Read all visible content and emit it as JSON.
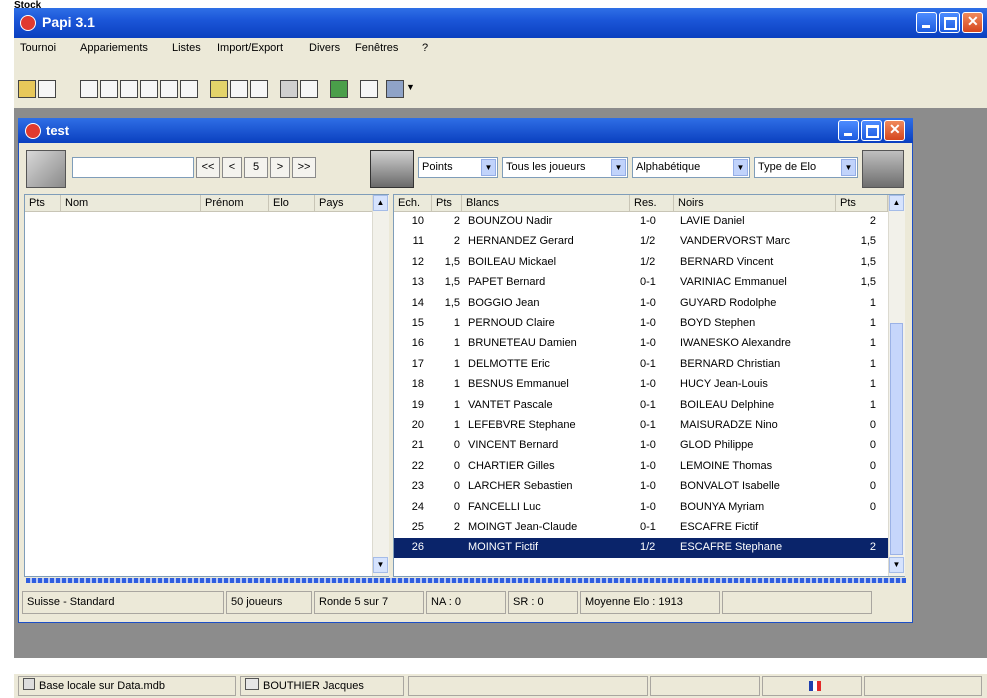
{
  "corner_label": "Stock",
  "app": {
    "title": "Papi 3.1"
  },
  "menu": [
    "Tournoi",
    "Appariements",
    "Listes",
    "Import/Export",
    "Divers",
    "Fenêtres",
    "?"
  ],
  "window": {
    "title": "test"
  },
  "nav": {
    "search_value": "",
    "first": "<<",
    "prev": "<",
    "round": "5",
    "next": ">",
    "last": ">>"
  },
  "filters": {
    "points": "Points",
    "players": "Tous les joueurs",
    "order": "Alphabétique",
    "elo_type": "Type de Elo"
  },
  "left_headers": [
    "Pts",
    "Nom",
    "Prénom",
    "Elo",
    "Pays"
  ],
  "right_headers": {
    "board": "Ech.",
    "pts": "Pts",
    "white": "Blancs",
    "res": "Res.",
    "black": "Noirs",
    "pts2": "Pts"
  },
  "pairings": [
    {
      "board": "10",
      "wpts": "2",
      "white": "BOUNZOU Nadir",
      "res": "1-0",
      "black": "LAVIE Daniel",
      "bpts": "2"
    },
    {
      "board": "11",
      "wpts": "2",
      "white": "HERNANDEZ Gerard",
      "res": "1/2",
      "black": "VANDERVORST Marc",
      "bpts": "1,5"
    },
    {
      "board": "12",
      "wpts": "1,5",
      "white": "BOILEAU Mickael",
      "res": "1/2",
      "black": "BERNARD Vincent",
      "bpts": "1,5"
    },
    {
      "board": "13",
      "wpts": "1,5",
      "white": "PAPET Bernard",
      "res": "0-1",
      "black": "VARINIAC Emmanuel",
      "bpts": "1,5"
    },
    {
      "board": "14",
      "wpts": "1,5",
      "white": "BOGGIO Jean",
      "res": "1-0",
      "black": "GUYARD Rodolphe",
      "bpts": "1"
    },
    {
      "board": "15",
      "wpts": "1",
      "white": "PERNOUD Claire",
      "res": "1-0",
      "black": "BOYD Stephen",
      "bpts": "1"
    },
    {
      "board": "16",
      "wpts": "1",
      "white": "BRUNETEAU Damien",
      "res": "1-0",
      "black": "IWANESKO Alexandre",
      "bpts": "1"
    },
    {
      "board": "17",
      "wpts": "1",
      "white": "DELMOTTE Eric",
      "res": "0-1",
      "black": "BERNARD Christian",
      "bpts": "1"
    },
    {
      "board": "18",
      "wpts": "1",
      "white": "BESNUS Emmanuel",
      "res": "1-0",
      "black": "HUCY Jean-Louis",
      "bpts": "1"
    },
    {
      "board": "19",
      "wpts": "1",
      "white": "VANTET Pascale",
      "res": "0-1",
      "black": "BOILEAU Delphine",
      "bpts": "1"
    },
    {
      "board": "20",
      "wpts": "1",
      "white": "LEFEBVRE Stephane",
      "res": "0-1",
      "black": "MAISURADZE Nino",
      "bpts": "0"
    },
    {
      "board": "21",
      "wpts": "0",
      "white": "VINCENT Bernard",
      "res": "1-0",
      "black": "GLOD Philippe",
      "bpts": "0"
    },
    {
      "board": "22",
      "wpts": "0",
      "white": "CHARTIER Gilles",
      "res": "1-0",
      "black": "LEMOINE Thomas",
      "bpts": "0"
    },
    {
      "board": "23",
      "wpts": "0",
      "white": "LARCHER Sebastien",
      "res": "1-0",
      "black": "BONVALOT Isabelle",
      "bpts": "0"
    },
    {
      "board": "24",
      "wpts": "0",
      "white": "FANCELLI Luc",
      "res": "1-0",
      "black": "BOUNYA Myriam",
      "bpts": "0"
    },
    {
      "board": "25",
      "wpts": "2",
      "white": "MOINGT Jean-Claude",
      "res": "0-1",
      "black": "ESCAFRE Fictif",
      "bpts": ""
    },
    {
      "board": "26",
      "wpts": "",
      "white": "MOINGT Fictif",
      "res": "1/2",
      "black": "ESCAFRE Stephane",
      "bpts": "2",
      "selected": true
    }
  ],
  "status": {
    "system": "Suisse - Standard",
    "players": "50 joueurs",
    "round": "Ronde 5 sur 7",
    "na": "NA : 0",
    "sr": "SR : 0",
    "avg_elo": "Moyenne Elo : 1913"
  },
  "bottom": {
    "db": "Base locale sur Data.mdb",
    "user": "BOUTHIER Jacques"
  },
  "colors": {
    "titlebar": "#0a3fbf",
    "selection": "#0a246a",
    "window_bg": "#ece9d8"
  }
}
